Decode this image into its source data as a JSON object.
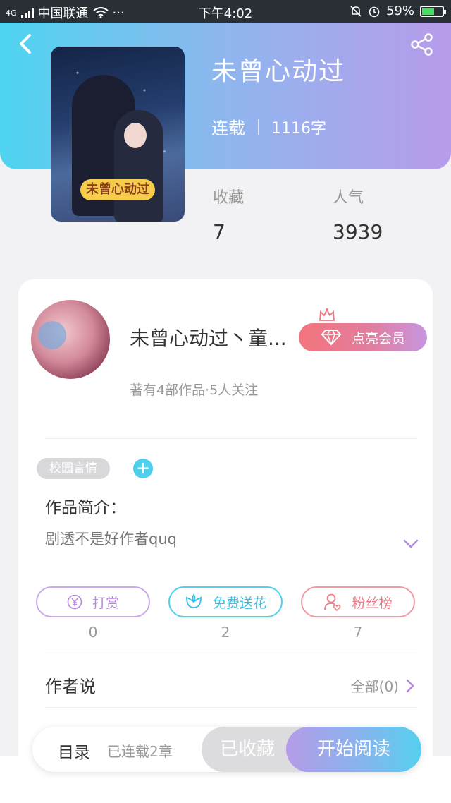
{
  "status_bar": {
    "network": "4G",
    "carrier": "中国联通",
    "dots": "···",
    "time": "下午4:02",
    "battery_percent": "59%",
    "battery_level": 0.59
  },
  "book": {
    "title": "未曾心动过",
    "status": "连载",
    "word_count": "1116字",
    "cover_tag": "未曾心动过",
    "stats": [
      {
        "label": "收藏",
        "value": "7"
      },
      {
        "label": "人气",
        "value": "3939"
      }
    ]
  },
  "author": {
    "name": "未曾心动过丶童...",
    "works_info": "著有4部作品·5人关注",
    "vip_button": "点亮会员"
  },
  "genre_tag": "校园言情",
  "intro": {
    "heading": "作品简介：",
    "text": "剧透不是好作者quq"
  },
  "actions": [
    {
      "label": "打赏",
      "count": "0",
      "icon": "yen-icon"
    },
    {
      "label": "免费送花",
      "count": "2",
      "icon": "flower-icon"
    },
    {
      "label": "粉丝榜",
      "count": "7",
      "icon": "fan-user-icon"
    }
  ],
  "author_says": {
    "title": "作者说",
    "all_label": "全部(0)"
  },
  "bottom_bar": {
    "toc_label": "目录",
    "chapters": "已连载2章",
    "favorited_label": "已收藏",
    "read_label": "开始阅读"
  },
  "colors": {
    "gradient_start": "#4ed4f0",
    "gradient_end": "#b89cec",
    "reward": "#b48ae0",
    "flower": "#33c1e6",
    "fans": "#ec7d89"
  }
}
